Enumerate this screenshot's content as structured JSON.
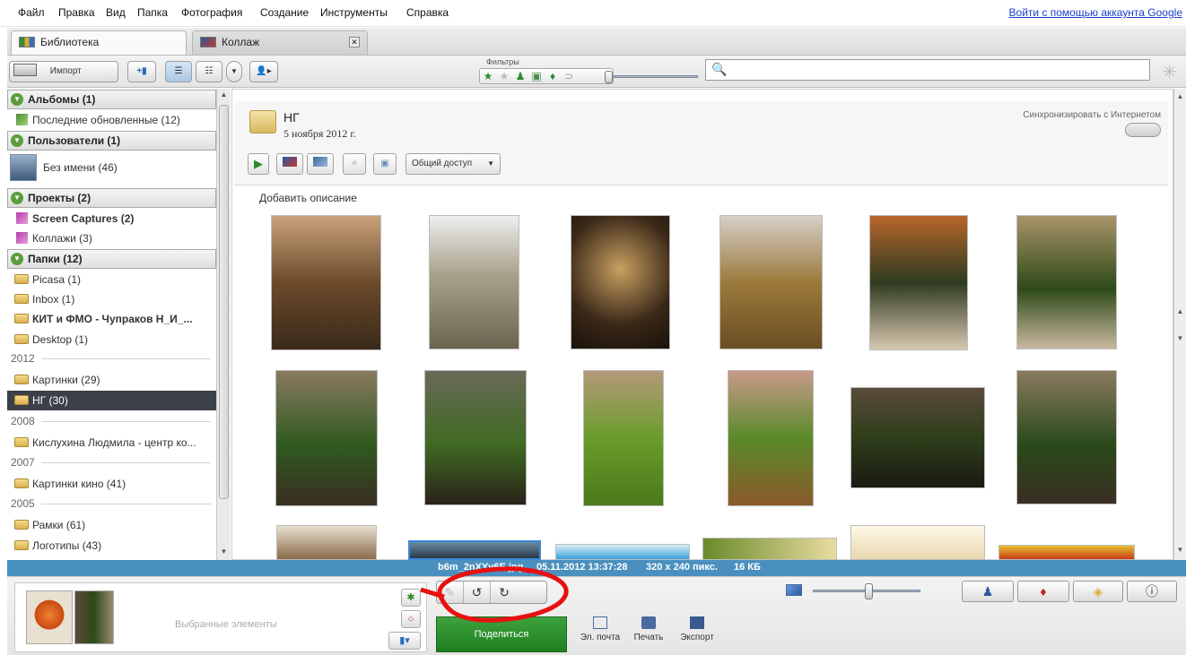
{
  "menu": {
    "items": [
      "Файл",
      "Правка",
      "Вид",
      "Папка",
      "Фотография",
      "Создание",
      "Инструменты",
      "Справка"
    ],
    "login": "Войти с помощью аккаунта Google"
  },
  "tabs": [
    {
      "label": "Библиотека",
      "active": true
    },
    {
      "label": "Коллаж",
      "active": false
    }
  ],
  "toolbar": {
    "import_label": "Импорт",
    "filters_label": "Фильтры",
    "search_placeholder": ""
  },
  "sidebar": {
    "albums": {
      "title": "Альбомы (1)",
      "items": [
        "Последние обновленные (12)"
      ]
    },
    "people": {
      "title": "Пользователи (1)",
      "items": [
        "Без имени (46)"
      ]
    },
    "projects": {
      "title": "Проекты (2)",
      "items": [
        "Screen Captures (2)",
        "Коллажи (3)"
      ]
    },
    "folders": {
      "title": "Папки (12)",
      "items": [
        "Picasa (1)",
        "Inbox (1)",
        "КИТ и ФМО - Чупраков Н_И_...",
        "Desktop (1)"
      ]
    },
    "year_2012": {
      "year": "2012",
      "items": [
        "Картинки (29)",
        "НГ (30)"
      ]
    },
    "year_2008": {
      "year": "2008",
      "items": [
        "Кислухина Людмила - центр ко..."
      ]
    },
    "year_2007": {
      "year": "2007",
      "items": [
        "Картинки кино (41)"
      ]
    },
    "year_2005": {
      "year": "2005",
      "items": [
        "Рамки (61)",
        "Логотипы (43)"
      ]
    }
  },
  "folder_header": {
    "title": "НГ",
    "date": "5 ноября 2012 г.",
    "sync_label": "Синхронизировать с Интернетом",
    "share_label": "Общий доступ",
    "add_description": "Добавить описание"
  },
  "status": {
    "filename": "b6m_2nXYy6E.jpg",
    "datetime": "05.11.2012 13:37:28",
    "dimensions": "320 x 240 пикс.",
    "filesize": "16 КБ"
  },
  "bottom": {
    "tray_label": "Выбранные элементы",
    "share_button": "Поделиться",
    "email": "Эл. почта",
    "print": "Печать",
    "export": "Экспорт"
  },
  "colors": {
    "selection": "#3c4048",
    "status_bar": "#4a90bf",
    "share_button": "#2e8f2e",
    "annotation": "#e81010"
  }
}
